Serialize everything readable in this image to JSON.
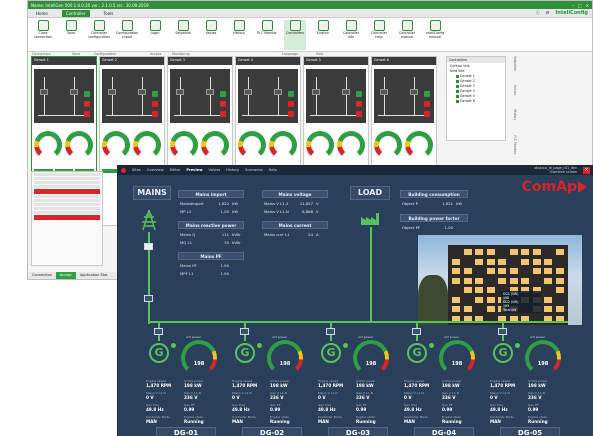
{
  "back": {
    "title": "InteliConfig",
    "titlebar_text": "Name: InteliGen 500 1.0.0.20     ver.: 2.1.0.5  rel.: 30.09.2019",
    "menu": [
      "Home",
      "Controller",
      "Tools"
    ],
    "menu_active": 1,
    "brand": "InteliConfig",
    "ribbon": [
      "Close connection",
      "Save",
      "Controller configuration",
      "Configuration import",
      "Login",
      "Setpoints",
      "Values",
      "History",
      "PLC Monitor",
      "Controllers",
      "English",
      "Controller info",
      "Controller help",
      "Controller manual",
      "InteliConfig manual"
    ],
    "ribbon_selected": 9,
    "ribbon_groups": [
      "Connection",
      "Save",
      "Configuration",
      "Access",
      "Monitoring",
      "Language",
      "Help"
    ],
    "controllers": [
      "Genset 1",
      "Genset 2",
      "Genset 3",
      "Genset 4",
      "Genset 5",
      "Genset 6"
    ],
    "side_title": "Controllers",
    "side_subtitle": "Control Unit",
    "side_site": "New Site",
    "side_items": [
      "Genset 1",
      "Genset 2",
      "Genset 3",
      "Genset 4",
      "Genset 5",
      "Genset 6"
    ],
    "side_tabs": [
      "Setpoints",
      "Values",
      "History",
      "PLC Monitor",
      "Controllers",
      "Modules"
    ],
    "status": [
      "Connection",
      "Accept",
      "Application Stat"
    ],
    "status_active": 1
  },
  "front": {
    "nav": [
      "Sites",
      "Overview",
      "Editor",
      "Preview",
      "Values",
      "History",
      "Scenarios",
      "Help"
    ],
    "nav_active": 3,
    "right_line1": "obvious_ie_page_c01_dev",
    "right_line2": "Overview screen",
    "brand": "ComAp",
    "mains_label": "MAINS",
    "load_label": "LOAD",
    "mains_import": {
      "title": "Mains import",
      "rows": [
        [
          "MainsImport",
          "1,622",
          "kW"
        ],
        [
          "MP L1",
          "1,05",
          "kW"
        ]
      ]
    },
    "mains_reactive": {
      "title": "Mains reactive power",
      "rows": [
        [
          "Mains Q",
          "111",
          "kVAr"
        ],
        [
          "MQ L1",
          "35",
          "kVAr"
        ]
      ]
    },
    "mains_pf": {
      "title": "Mains PF",
      "rows": [
        [
          "Mains PF",
          "1.00",
          ""
        ],
        [
          "MPF L1",
          "1.00",
          ""
        ]
      ]
    },
    "mains_voltage": {
      "title": "Mains voltage",
      "rows": [
        [
          "Mains V L1-2",
          "11,857",
          "V"
        ],
        [
          "Mains V L1-N",
          "6,866",
          "V"
        ]
      ]
    },
    "mains_current": {
      "title": "Mains current",
      "rows": [
        [
          "Mains curr L1",
          "24",
          "A"
        ]
      ]
    },
    "building_consumption": {
      "title": "Building consumption",
      "rows": [
        [
          "Object P",
          "1,621",
          "kW"
        ]
      ]
    },
    "building_pf": {
      "title": "Building power factor",
      "rows": [
        [
          "Object PF",
          "1.00",
          ""
        ]
      ]
    },
    "photo_overlay": [
      "DG1 (kW)",
      "198",
      "DG2 (kW)",
      "199",
      "Total kW"
    ],
    "generators": [
      {
        "name": "DG-01",
        "kw": "198",
        "rpm": "1,470 RPM",
        "pwr": "198 kW",
        "v": "0 V",
        "vg": "236 V",
        "hz": "49.8 Hz",
        "pf": "0.99",
        "mode": "MAN",
        "state": "Running"
      },
      {
        "name": "DG-02",
        "kw": "198",
        "rpm": "1,470 RPM",
        "pwr": "198 kW",
        "v": "0 V",
        "vg": "236 V",
        "hz": "49.8 Hz",
        "pf": "0.99",
        "mode": "MAN",
        "state": "Running"
      },
      {
        "name": "DG-03",
        "kw": "198",
        "rpm": "1,470 RPM",
        "pwr": "198 kW",
        "v": "0 V",
        "vg": "236 V",
        "hz": "49.8 Hz",
        "pf": "0.99",
        "mode": "MAN",
        "state": "Running"
      },
      {
        "name": "DG-04",
        "kw": "198",
        "rpm": "1,470 RPM",
        "pwr": "198 kW",
        "v": "0 V",
        "vg": "236 V",
        "hz": "49.8 Hz",
        "pf": "0.99",
        "mode": "MAN",
        "state": "Running"
      },
      {
        "name": "DG-05",
        "kw": "198",
        "rpm": "1,470 RPM",
        "pwr": "198 kW",
        "v": "0 V",
        "vg": "236 V",
        "hz": "49.8 Hz",
        "pf": "0.99",
        "mode": "MAN",
        "state": "Running"
      }
    ],
    "gen_caption": "Act power",
    "gen_labels": {
      "speed": "Engine speed",
      "power": "Active power",
      "mv": "Mains V L1-N",
      "gv": "Gen V L1-N",
      "hz": "Gen freq",
      "pf": "Gen PF",
      "mode": "Controller Mode",
      "state": "Engine state"
    }
  },
  "colors": {
    "accent_green": "#2ea043",
    "front_bg": "#2a3f5a",
    "comap_red": "#d6262b"
  }
}
